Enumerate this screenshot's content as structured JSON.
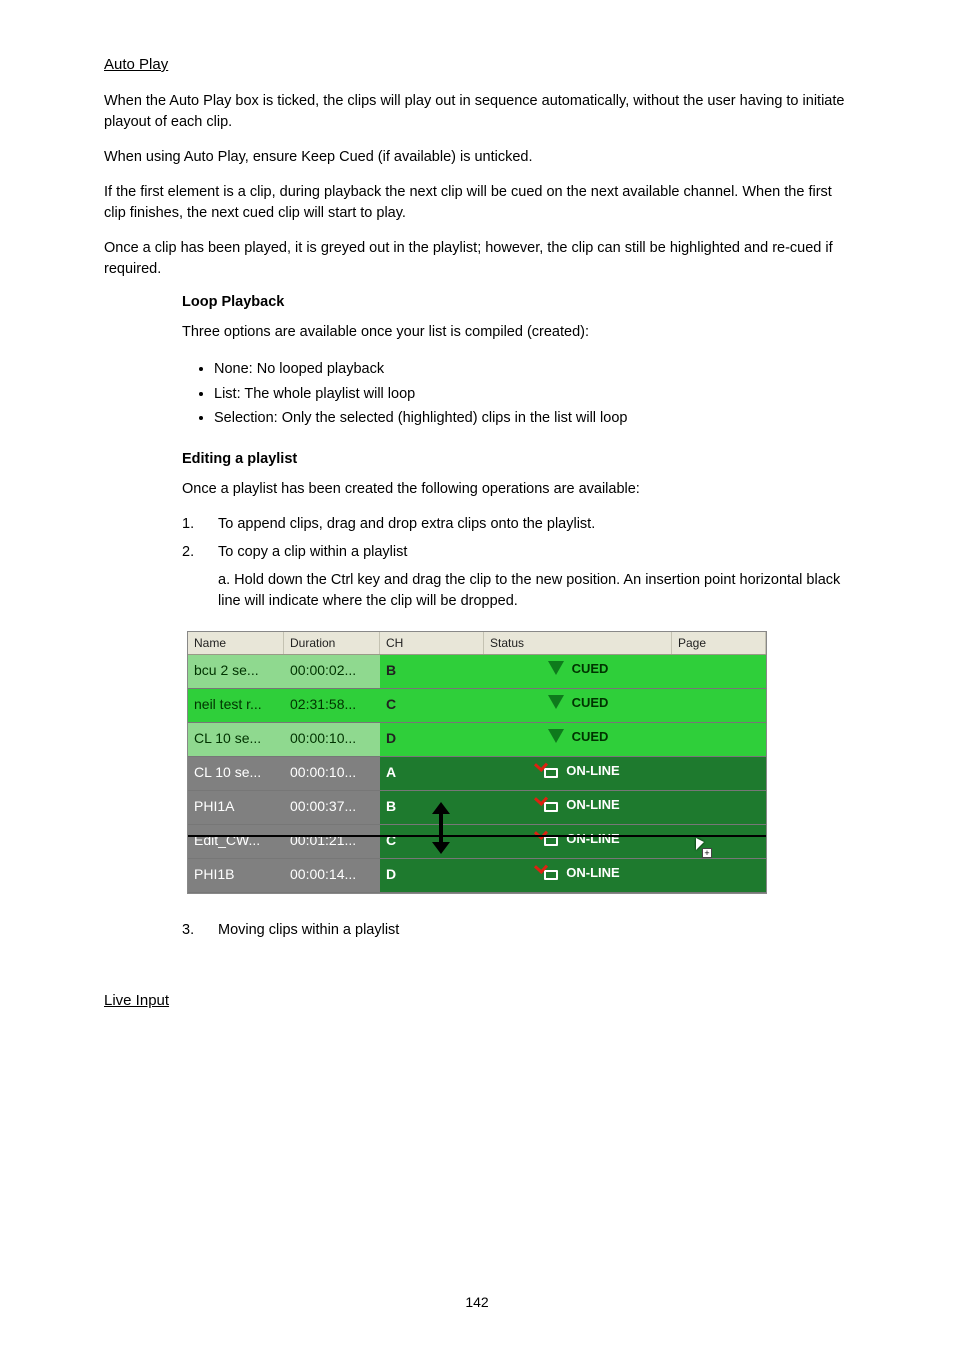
{
  "section1_title": "Auto Play",
  "p1": "When the Auto Play box is ticked, the clips will play out in sequence automatically, without the user having to initiate playout of each clip.",
  "p2": "When using Auto Play, ensure Keep Cued (if available) is unticked.",
  "p3": "If the first element is a clip, during playback the next clip will be cued on the next available channel. When the first clip finishes, the next cued clip will start to play.",
  "p4": "Once a clip has been played, it is greyed out in the playlist; however, the clip can still be highlighted and re-cued if required.",
  "sub1": "Loop Playback",
  "s1p1": "Three options are available once your list is compiled (created):",
  "bullets": [
    "None: No looped playback",
    "List: The whole playlist will loop",
    "Selection: Only the selected (highlighted) clips in the list will loop"
  ],
  "sub2": "Editing a playlist",
  "s2p1": "Once a playlist has been created the following operations are available:",
  "steps": [
    {
      "n": "1.",
      "t": "To append clips, drag and drop extra clips onto the playlist."
    },
    {
      "n": "2.",
      "t": "To copy a clip within a playlist"
    },
    {
      "sub": "a. Hold down the Ctrl key and drag the clip to the new position. An insertion point horizontal black line will indicate where the clip will be dropped."
    }
  ],
  "table": {
    "headers": {
      "name": "Name",
      "duration": "Duration",
      "ch": "CH",
      "status": "Status",
      "page": "Page"
    },
    "rows": [
      {
        "name": "bcu 2 se...",
        "duration": "00:00:02...",
        "ch": "B",
        "status": "CUED",
        "mode": "cued"
      },
      {
        "name": "neil test r...",
        "duration": "02:31:58...",
        "ch": "C",
        "status": "CUED",
        "mode": "cued",
        "selected": true
      },
      {
        "name": "CL 10 se...",
        "duration": "00:00:10...",
        "ch": "D",
        "status": "CUED",
        "mode": "cued"
      },
      {
        "name": "CL 10 se...",
        "duration": "00:00:10...",
        "ch": "A",
        "status": "ON-LINE",
        "mode": "online"
      },
      {
        "name": "PHI1A",
        "duration": "00:00:37...",
        "ch": "B",
        "status": "ON-LINE",
        "mode": "online"
      },
      {
        "name": "Edit_CW...",
        "duration": "00:01:21...",
        "ch": "C",
        "status": "ON-LINE",
        "mode": "online"
      },
      {
        "name": "PHI1B",
        "duration": "00:00:14...",
        "ch": "D",
        "status": "ON-LINE",
        "mode": "online"
      }
    ]
  },
  "step3": {
    "n": "3.",
    "t": "Moving clips within a playlist"
  },
  "section2_title": "Live Input",
  "page_number": "142"
}
